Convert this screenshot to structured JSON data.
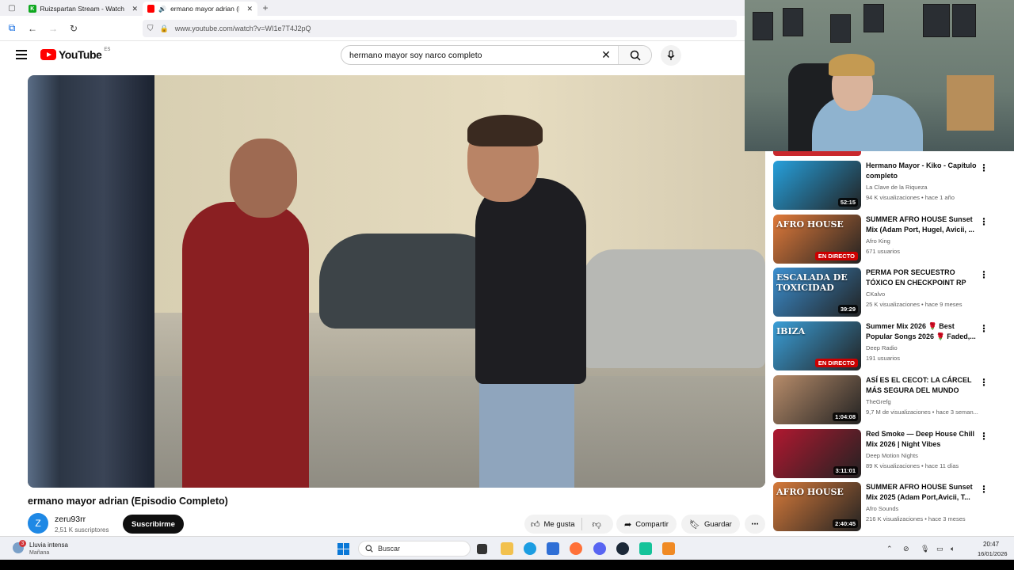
{
  "tabs": [
    {
      "title": "Ruizspartan Stream - Watch Liv",
      "favicon_color": "#0fa81f",
      "favicon_letter": "K"
    },
    {
      "title": "ermano mayor adrian (Epis",
      "favicon_color": "#ff0000"
    }
  ],
  "url": "www.youtube.com/watch?v=WI1e7T4J2pQ",
  "youtube": {
    "logo_text": "YouTube",
    "country": "ES",
    "search_value": "hermano mayor soy narco completo"
  },
  "video": {
    "title": "ermano mayor adrian (Episodio Completo)",
    "channel": "zeru93rr",
    "channel_initial": "Z",
    "subscribers": "2,51 K suscriptores",
    "subscribe_label": "Suscribirme",
    "like_label": "Me gusta",
    "share_label": "Compartir",
    "save_label": "Guardar"
  },
  "recommendations": [
    {
      "title": "Hermano Mayor - Kiko - Capítulo completo",
      "channel": "La Clave de la Riqueza",
      "meta": "94 K visualizaciones • hace 1 año",
      "badge": "52:15",
      "live": false,
      "thumb": "#26a0dc"
    },
    {
      "title": "SUMMER AFRO HOUSE Sunset Mix (Adam Port, Hugel, Avicii, ...",
      "channel": "Afro King",
      "meta": "671 usuarios",
      "badge": "EN DIRECTO",
      "live": true,
      "thumb": "#e07a3a",
      "thumb_text": "AFRO HOUSE"
    },
    {
      "title": "PERMA POR SECUESTRO TÓXICO EN CHECKPOINT RP",
      "channel": "CKalvo",
      "meta": "25 K visualizaciones • hace 9 meses",
      "badge": "39:29",
      "live": false,
      "thumb": "#3b8fd0",
      "thumb_text": "ESCALADA DE TOXICIDAD"
    },
    {
      "title": "Summer Mix 2026 🌹 Best Popular Songs 2026 🌹 Faded,...",
      "channel": "Deep Radio",
      "meta": "191 usuarios",
      "badge": "EN DIRECTO",
      "live": true,
      "thumb": "#3a9fd8",
      "thumb_text": "IBIZA"
    },
    {
      "title": "ASÍ ES EL CECOT: LA CÁRCEL MÁS SEGURA DEL MUNDO",
      "channel": "TheGrefg",
      "meta": "9,7 M de visualizaciones • hace 3 seman...",
      "badge": "1:04:08",
      "live": false,
      "thumb": "#b78c6a"
    },
    {
      "title": "Red Smoke — Deep House Chill Mix 2026 | Night Vibes",
      "channel": "Deep Motion Nights",
      "meta": "89 K visualizaciones • hace 11 días",
      "badge": "3:11:01",
      "live": false,
      "thumb": "#b01830"
    },
    {
      "title": "SUMMER AFRO HOUSE Sunset Mix 2025 (Adam Port,Avicii, T...",
      "channel": "Afro Sounds",
      "meta": "216 K visualizaciones • hace 3 meses",
      "badge": "2:40:45",
      "live": false,
      "thumb": "#d67a3a",
      "thumb_text": "AFRO HOUSE"
    }
  ],
  "taskbar": {
    "weather": "Lluvia intensa",
    "weather_sub": "Mañana",
    "weather_badge": "3",
    "search_placeholder": "Buscar",
    "time": "20:47",
    "date": "16/01/2026"
  }
}
